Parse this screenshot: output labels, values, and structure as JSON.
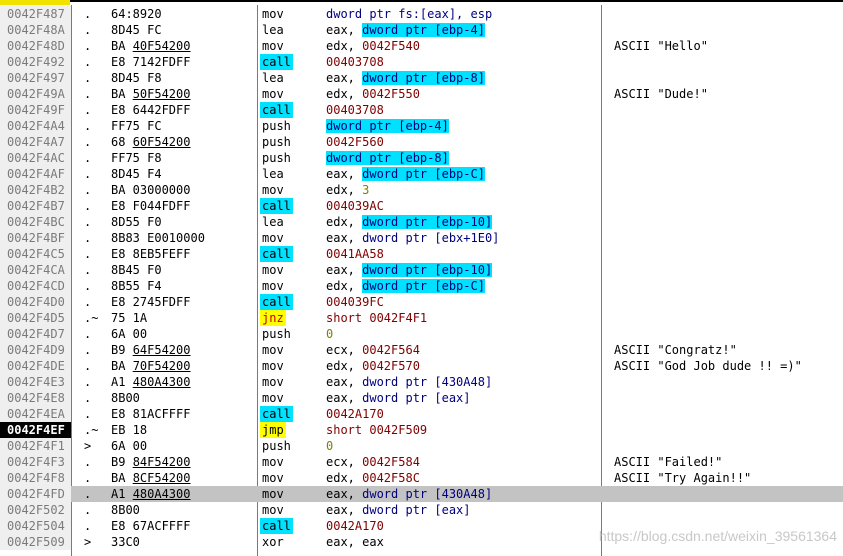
{
  "rows": [
    {
      "addr": "0042F487",
      "mark": ".",
      "hex": "64:8920",
      "hex_u": "",
      "mn": "mov",
      "mnType": "",
      "op": [
        [
          "dword ptr fs:[eax], esp",
          "dw"
        ]
      ],
      "comment": ""
    },
    {
      "addr": "0042F48A",
      "mark": ".",
      "hex": "8D45 FC",
      "hex_u": "",
      "mn": "lea",
      "mnType": "",
      "op": [
        [
          "eax, ",
          ""
        ],
        [
          "dword ptr [ebp-4]",
          "mem"
        ]
      ],
      "comment": ""
    },
    {
      "addr": "0042F48D",
      "mark": ".",
      "hex": "BA ",
      "hex_u": "40F54200",
      "mn": "mov",
      "mnType": "",
      "op": [
        [
          "edx, ",
          ""
        ],
        [
          "0042F540",
          "num"
        ]
      ],
      "comment": "ASCII \"Hello\""
    },
    {
      "addr": "0042F492",
      "mark": ".",
      "hex": "E8 7142FDFF",
      "hex_u": "",
      "mn": "call",
      "mnType": "call",
      "op": [
        [
          "00403708",
          "num"
        ]
      ],
      "comment": ""
    },
    {
      "addr": "0042F497",
      "mark": ".",
      "hex": "8D45 F8",
      "hex_u": "",
      "mn": "lea",
      "mnType": "",
      "op": [
        [
          "eax, ",
          ""
        ],
        [
          "dword ptr [ebp-8]",
          "mem"
        ]
      ],
      "comment": ""
    },
    {
      "addr": "0042F49A",
      "mark": ".",
      "hex": "BA ",
      "hex_u": "50F54200",
      "mn": "mov",
      "mnType": "",
      "op": [
        [
          "edx, ",
          ""
        ],
        [
          "0042F550",
          "num"
        ]
      ],
      "comment": "ASCII \"Dude!\""
    },
    {
      "addr": "0042F49F",
      "mark": ".",
      "hex": "E8 6442FDFF",
      "hex_u": "",
      "mn": "call",
      "mnType": "call",
      "op": [
        [
          "00403708",
          "num"
        ]
      ],
      "comment": ""
    },
    {
      "addr": "0042F4A4",
      "mark": ".",
      "hex": "FF75 FC",
      "hex_u": "",
      "mn": "push",
      "mnType": "",
      "op": [
        [
          "dword ptr [ebp-4]",
          "mem"
        ]
      ],
      "comment": ""
    },
    {
      "addr": "0042F4A7",
      "mark": ".",
      "hex": "68 ",
      "hex_u": "60F54200",
      "mn": "push",
      "mnType": "",
      "op": [
        [
          "0042F560",
          "num"
        ]
      ],
      "comment": ""
    },
    {
      "addr": "0042F4AC",
      "mark": ".",
      "hex": "FF75 F8",
      "hex_u": "",
      "mn": "push",
      "mnType": "",
      "op": [
        [
          "dword ptr [ebp-8]",
          "mem"
        ]
      ],
      "comment": ""
    },
    {
      "addr": "0042F4AF",
      "mark": ".",
      "hex": "8D45 F4",
      "hex_u": "",
      "mn": "lea",
      "mnType": "",
      "op": [
        [
          "eax, ",
          ""
        ],
        [
          "dword ptr [ebp-C]",
          "mem"
        ]
      ],
      "comment": ""
    },
    {
      "addr": "0042F4B2",
      "mark": ".",
      "hex": "BA 03000000",
      "hex_u": "",
      "mn": "mov",
      "mnType": "",
      "op": [
        [
          "edx, ",
          ""
        ],
        [
          "3",
          "imm"
        ]
      ],
      "comment": ""
    },
    {
      "addr": "0042F4B7",
      "mark": ".",
      "hex": "E8 F044FDFF",
      "hex_u": "",
      "mn": "call",
      "mnType": "call",
      "op": [
        [
          "004039AC",
          "num"
        ]
      ],
      "comment": ""
    },
    {
      "addr": "0042F4BC",
      "mark": ".",
      "hex": "8D55 F0",
      "hex_u": "",
      "mn": "lea",
      "mnType": "",
      "op": [
        [
          "edx, ",
          ""
        ],
        [
          "dword ptr [ebp-10]",
          "mem"
        ]
      ],
      "comment": ""
    },
    {
      "addr": "0042F4BF",
      "mark": ".",
      "hex": "8B83 E0010000",
      "hex_u": "",
      "mn": "mov",
      "mnType": "",
      "op": [
        [
          "eax, ",
          ""
        ],
        [
          "dword ptr [ebx+1E0]",
          "dw"
        ]
      ],
      "comment": ""
    },
    {
      "addr": "0042F4C5",
      "mark": ".",
      "hex": "E8 8EB5FEFF",
      "hex_u": "",
      "mn": "call",
      "mnType": "call",
      "op": [
        [
          "0041AA58",
          "num"
        ]
      ],
      "comment": ""
    },
    {
      "addr": "0042F4CA",
      "mark": ".",
      "hex": "8B45 F0",
      "hex_u": "",
      "mn": "mov",
      "mnType": "",
      "op": [
        [
          "eax, ",
          ""
        ],
        [
          "dword ptr [ebp-10]",
          "mem"
        ]
      ],
      "comment": ""
    },
    {
      "addr": "0042F4CD",
      "mark": ".",
      "hex": "8B55 F4",
      "hex_u": "",
      "mn": "mov",
      "mnType": "",
      "op": [
        [
          "edx, ",
          ""
        ],
        [
          "dword ptr [ebp-C]",
          "mem"
        ]
      ],
      "comment": ""
    },
    {
      "addr": "0042F4D0",
      "mark": ".",
      "hex": "E8 2745FDFF",
      "hex_u": "",
      "mn": "call",
      "mnType": "call",
      "op": [
        [
          "004039FC",
          "num"
        ]
      ],
      "comment": ""
    },
    {
      "addr": "0042F4D5",
      "mark": ".~",
      "hex": "75 1A",
      "hex_u": "",
      "mn": "jnz",
      "mnType": "jnz",
      "op": [
        [
          "short 0042F4F1",
          "num"
        ]
      ],
      "comment": ""
    },
    {
      "addr": "0042F4D7",
      "mark": ".",
      "hex": "6A 00",
      "hex_u": "",
      "mn": "push",
      "mnType": "",
      "op": [
        [
          "0",
          "imm"
        ]
      ],
      "comment": ""
    },
    {
      "addr": "0042F4D9",
      "mark": ".",
      "hex": "B9 ",
      "hex_u": "64F54200",
      "mn": "mov",
      "mnType": "",
      "op": [
        [
          "ecx, ",
          ""
        ],
        [
          "0042F564",
          "num"
        ]
      ],
      "comment": "ASCII \"Congratz!\""
    },
    {
      "addr": "0042F4DE",
      "mark": ".",
      "hex": "BA ",
      "hex_u": "70F54200",
      "mn": "mov",
      "mnType": "",
      "op": [
        [
          "edx, ",
          ""
        ],
        [
          "0042F570",
          "num"
        ]
      ],
      "comment": "ASCII \"God Job dude !! =)\""
    },
    {
      "addr": "0042F4E3",
      "mark": ".",
      "hex": "A1 ",
      "hex_u": "480A4300",
      "mn": "mov",
      "mnType": "",
      "op": [
        [
          "eax, ",
          ""
        ],
        [
          "dword ptr [430A48]",
          "dw"
        ]
      ],
      "comment": ""
    },
    {
      "addr": "0042F4E8",
      "mark": ".",
      "hex": "8B00",
      "hex_u": "",
      "mn": "mov",
      "mnType": "",
      "op": [
        [
          "eax, ",
          ""
        ],
        [
          "dword ptr [eax]",
          "dw"
        ]
      ],
      "comment": ""
    },
    {
      "addr": "0042F4EA",
      "mark": ".",
      "hex": "E8 81ACFFFF",
      "hex_u": "",
      "mn": "call",
      "mnType": "call",
      "op": [
        [
          "0042A170",
          "num"
        ]
      ],
      "comment": ""
    },
    {
      "addr": "0042F4EF",
      "mark": ".~",
      "hex": "EB 18",
      "hex_u": "",
      "mn": "jmp",
      "mnType": "jmp",
      "op": [
        [
          "short 0042F509",
          "num"
        ]
      ],
      "comment": "",
      "cur": true
    },
    {
      "addr": "0042F4F1",
      "mark": ">",
      "hex": "6A 00",
      "hex_u": "",
      "mn": "push",
      "mnType": "",
      "op": [
        [
          "0",
          "imm"
        ]
      ],
      "comment": ""
    },
    {
      "addr": "0042F4F3",
      "mark": ".",
      "hex": "B9 ",
      "hex_u": "84F54200",
      "mn": "mov",
      "mnType": "",
      "op": [
        [
          "ecx, ",
          ""
        ],
        [
          "0042F584",
          "num"
        ]
      ],
      "comment": "ASCII \"Failed!\""
    },
    {
      "addr": "0042F4F8",
      "mark": ".",
      "hex": "BA ",
      "hex_u": "8CF54200",
      "mn": "mov",
      "mnType": "",
      "op": [
        [
          "edx, ",
          ""
        ],
        [
          "0042F58C",
          "num"
        ]
      ],
      "comment": "ASCII \"Try Again!!\""
    },
    {
      "addr": "0042F4FD",
      "mark": ".",
      "hex": "A1 ",
      "hex_u": "480A4300",
      "mn": "mov",
      "mnType": "",
      "op": [
        [
          "eax, ",
          ""
        ],
        [
          "dword ptr [430A48]",
          "dw"
        ]
      ],
      "comment": "",
      "sel": true
    },
    {
      "addr": "0042F502",
      "mark": ".",
      "hex": "8B00",
      "hex_u": "",
      "mn": "mov",
      "mnType": "",
      "op": [
        [
          "eax, ",
          ""
        ],
        [
          "dword ptr [eax]",
          "dw"
        ]
      ],
      "comment": ""
    },
    {
      "addr": "0042F504",
      "mark": ".",
      "hex": "E8 67ACFFFF",
      "hex_u": "",
      "mn": "call",
      "mnType": "call",
      "op": [
        [
          "0042A170",
          "num"
        ]
      ],
      "comment": ""
    },
    {
      "addr": "0042F509",
      "mark": ">",
      "hex": "33C0",
      "hex_u": "",
      "mn": "xor",
      "mnType": "",
      "op": [
        [
          "eax, eax",
          ""
        ]
      ],
      "comment": ""
    }
  ],
  "watermark": "https://blog.csdn.net/weixin_39561364"
}
